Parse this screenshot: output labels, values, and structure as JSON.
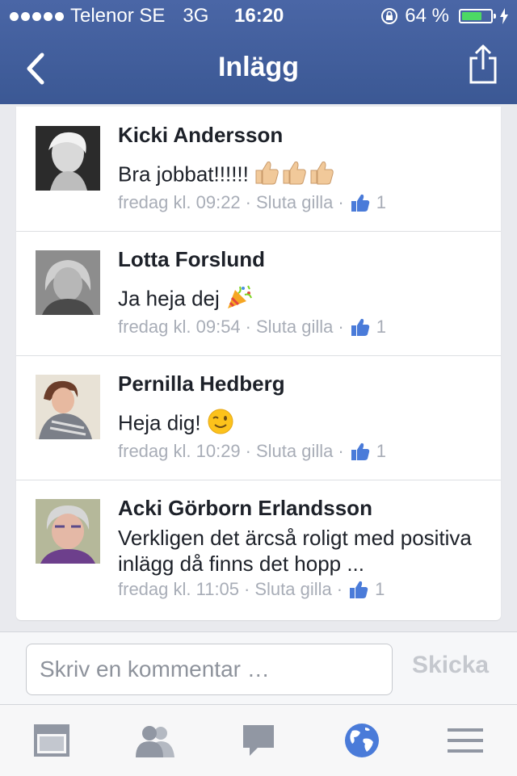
{
  "status_bar": {
    "carrier": "Telenor SE",
    "network": "3G",
    "time": "16:20",
    "battery": "64 %",
    "battery_level": 0.64
  },
  "nav": {
    "title": "Inlägg"
  },
  "comments": [
    {
      "author": "Kicki Andersson",
      "text": "Bra jobbat!!!!!!",
      "emoji": "thumbs-up x3",
      "timestamp": "fredag kl. 09:22",
      "action": "Sluta gilla",
      "likes": "1"
    },
    {
      "author": "Lotta Forslund",
      "text": "Ja heja dej",
      "emoji": "party-popper",
      "timestamp": "fredag kl. 09:54",
      "action": "Sluta gilla",
      "likes": "1"
    },
    {
      "author": "Pernilla Hedberg",
      "text": "Heja dig!",
      "emoji": "winking-face",
      "timestamp": "fredag kl. 10:29",
      "action": "Sluta gilla",
      "likes": "1"
    },
    {
      "author": "Acki Görborn Erlandsson",
      "text": "Verkligen det ärcså roligt med positiva inlägg då finns det hopp ...",
      "emoji": "",
      "timestamp": "fredag kl. 11:05",
      "action": "Sluta gilla",
      "likes": "1"
    }
  ],
  "separator": "·",
  "composer": {
    "placeholder": "Skriv en kommentar …",
    "send_label": "Skicka"
  },
  "tabs": [
    {
      "icon": "news-feed-icon",
      "active": false
    },
    {
      "icon": "friends-icon",
      "active": false
    },
    {
      "icon": "messages-icon",
      "active": false
    },
    {
      "icon": "globe-icon",
      "active": true
    },
    {
      "icon": "menu-icon",
      "active": false
    }
  ],
  "colors": {
    "brand": "#3b5998",
    "like_blue": "#4a7bd9",
    "meta_gray": "#a8adb7"
  }
}
